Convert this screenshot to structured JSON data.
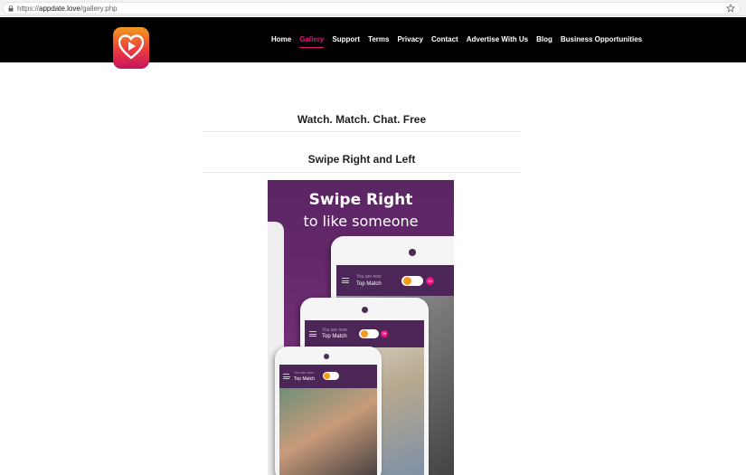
{
  "browser": {
    "url_scheme": "https://",
    "url_host": "appdate.love",
    "url_path": "/gallery.php"
  },
  "header": {
    "logo_name": "appdate-heart-play-logo",
    "nav": [
      {
        "label": "Home",
        "active": false
      },
      {
        "label": "Gallery",
        "active": true
      },
      {
        "label": "Support",
        "active": false
      },
      {
        "label": "Terms",
        "active": false
      },
      {
        "label": "Privacy",
        "active": false
      },
      {
        "label": "Contact",
        "active": false
      },
      {
        "label": "Advertise With Us",
        "active": false
      },
      {
        "label": "Blog",
        "active": false
      },
      {
        "label": "Business Opportunities",
        "active": false
      }
    ],
    "colors": {
      "background": "#000000",
      "nav_text": "#ffffff",
      "active": "#e6137c"
    }
  },
  "main": {
    "heading": "Watch. Match. Chat. Free",
    "subheading": "Swipe Right and Left",
    "gallery_image": {
      "headline_line1": "Swipe Right",
      "headline_line2": "to like someone",
      "phone_subtitle": "You are now",
      "phone_title": "Top Match",
      "badge_count": "29"
    }
  }
}
